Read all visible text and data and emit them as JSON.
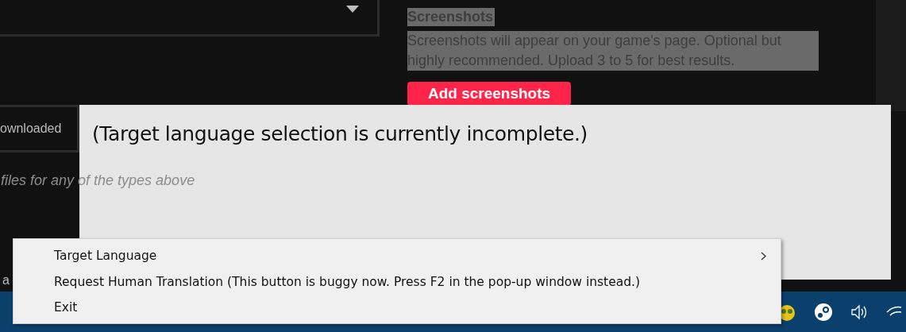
{
  "background_page": {
    "field_value": "ownloaded",
    "hint": "files for any of the types above",
    "edge_fragment": "a",
    "screenshots": {
      "title": "Screenshots",
      "description": "Screenshots will appear on your game's page. Optional but highly recommended. Upload 3 to 5 for best results.",
      "button": "Add screenshots"
    }
  },
  "message_window": {
    "text": "(Target language selection is currently incomplete.)"
  },
  "context_menu": {
    "items": [
      {
        "label": "Target Language",
        "has_submenu": true
      },
      {
        "label": "Request Human Translation (This button is buggy now. Press F2 in the pop-up window instead.)",
        "has_submenu": false
      },
      {
        "label": "Exit",
        "has_submenu": false
      }
    ]
  }
}
